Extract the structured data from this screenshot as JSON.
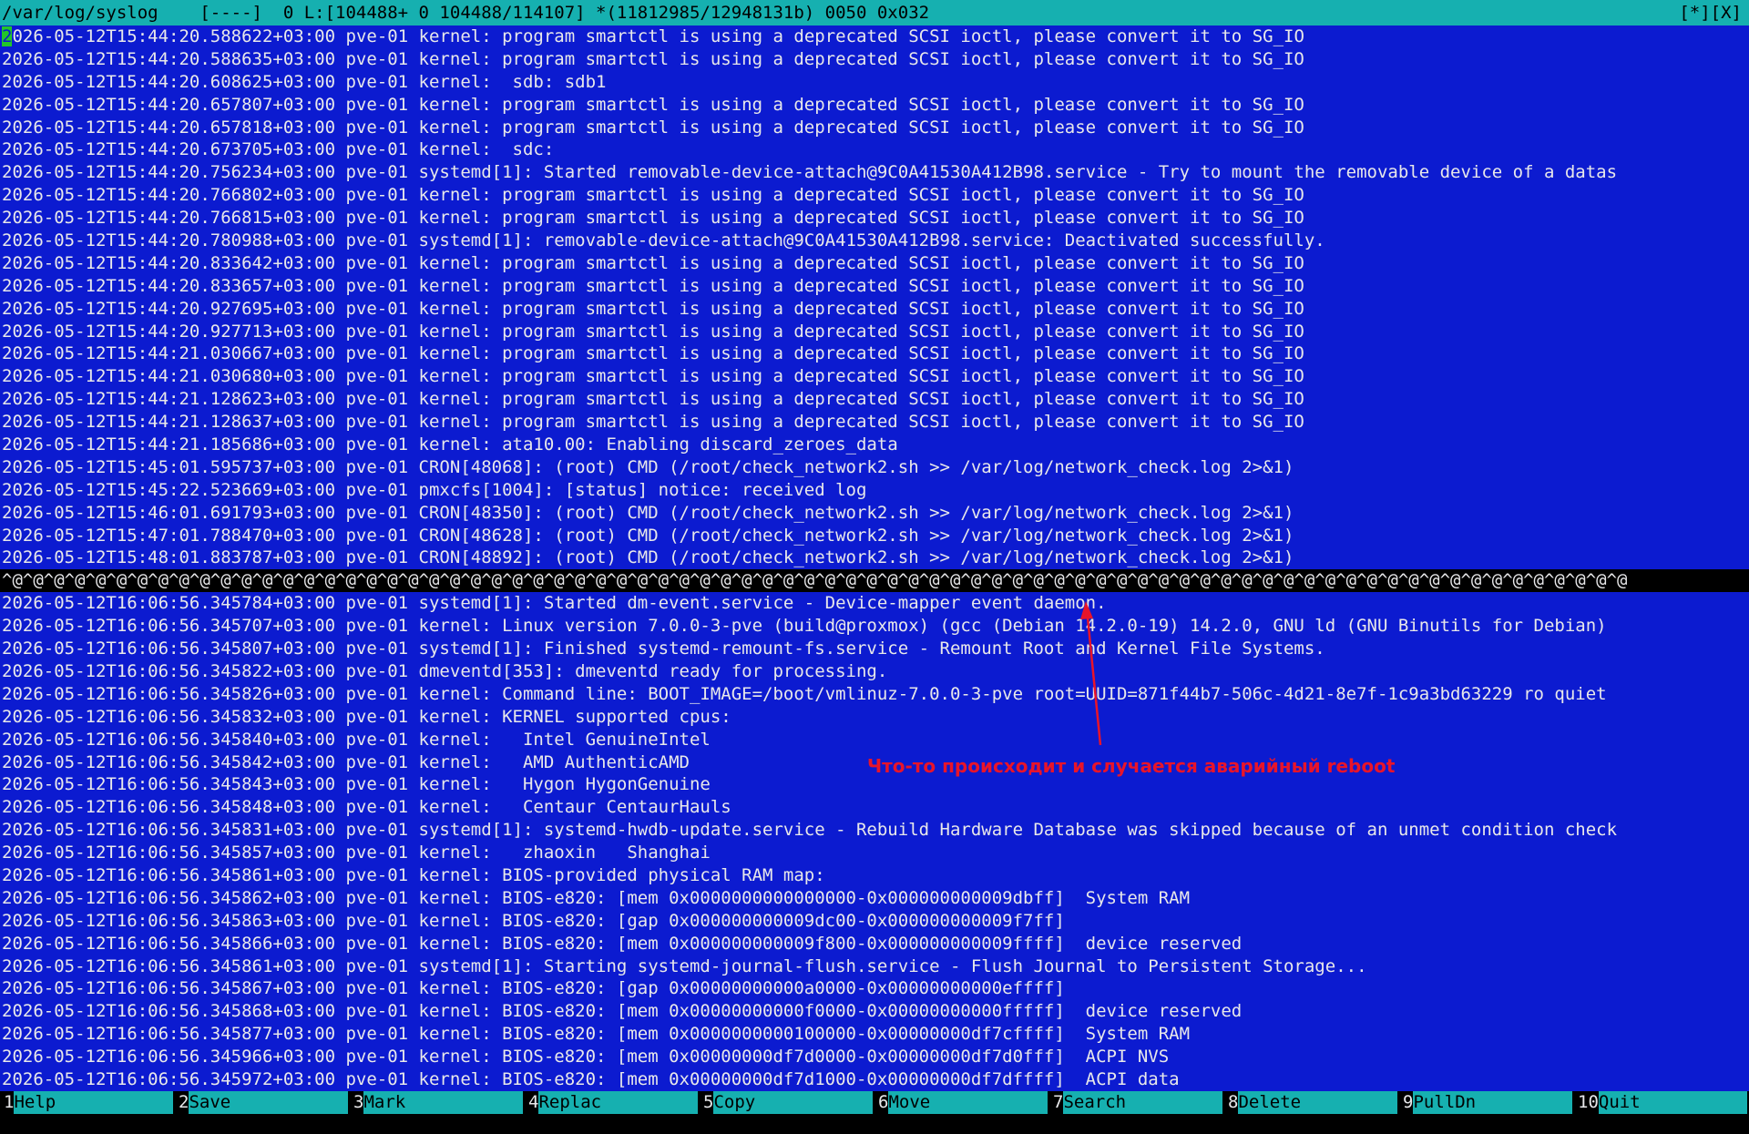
{
  "status": {
    "left": "/var/log/syslog    [----]  0 L:[104488+ 0 104488/114107] *(11812985/12948131b) 0050 0x032",
    "right": "[*][X]"
  },
  "cursor_char": "2",
  "lines": [
    "2026-05-12T15:44:20.588622+03:00 pve-01 kernel: program smartctl is using a deprecated SCSI ioctl, please convert it to SG_IO",
    "2026-05-12T15:44:20.588635+03:00 pve-01 kernel: program smartctl is using a deprecated SCSI ioctl, please convert it to SG_IO",
    "2026-05-12T15:44:20.608625+03:00 pve-01 kernel:  sdb: sdb1",
    "2026-05-12T15:44:20.657807+03:00 pve-01 kernel: program smartctl is using a deprecated SCSI ioctl, please convert it to SG_IO",
    "2026-05-12T15:44:20.657818+03:00 pve-01 kernel: program smartctl is using a deprecated SCSI ioctl, please convert it to SG_IO",
    "2026-05-12T15:44:20.673705+03:00 pve-01 kernel:  sdc:",
    "2026-05-12T15:44:20.756234+03:00 pve-01 systemd[1]: Started removable-device-attach@9C0A41530A412B98.service - Try to mount the removable device of a datas",
    "2026-05-12T15:44:20.766802+03:00 pve-01 kernel: program smartctl is using a deprecated SCSI ioctl, please convert it to SG_IO",
    "2026-05-12T15:44:20.766815+03:00 pve-01 kernel: program smartctl is using a deprecated SCSI ioctl, please convert it to SG_IO",
    "2026-05-12T15:44:20.780988+03:00 pve-01 systemd[1]: removable-device-attach@9C0A41530A412B98.service: Deactivated successfully.",
    "2026-05-12T15:44:20.833642+03:00 pve-01 kernel: program smartctl is using a deprecated SCSI ioctl, please convert it to SG_IO",
    "2026-05-12T15:44:20.833657+03:00 pve-01 kernel: program smartctl is using a deprecated SCSI ioctl, please convert it to SG_IO",
    "2026-05-12T15:44:20.927695+03:00 pve-01 kernel: program smartctl is using a deprecated SCSI ioctl, please convert it to SG_IO",
    "2026-05-12T15:44:20.927713+03:00 pve-01 kernel: program smartctl is using a deprecated SCSI ioctl, please convert it to SG_IO",
    "2026-05-12T15:44:21.030667+03:00 pve-01 kernel: program smartctl is using a deprecated SCSI ioctl, please convert it to SG_IO",
    "2026-05-12T15:44:21.030680+03:00 pve-01 kernel: program smartctl is using a deprecated SCSI ioctl, please convert it to SG_IO",
    "2026-05-12T15:44:21.128623+03:00 pve-01 kernel: program smartctl is using a deprecated SCSI ioctl, please convert it to SG_IO",
    "2026-05-12T15:44:21.128637+03:00 pve-01 kernel: program smartctl is using a deprecated SCSI ioctl, please convert it to SG_IO",
    "2026-05-12T15:44:21.185686+03:00 pve-01 kernel: ata10.00: Enabling discard_zeroes_data",
    "2026-05-12T15:45:01.595737+03:00 pve-01 CRON[48068]: (root) CMD (/root/check_network2.sh >> /var/log/network_check.log 2>&1)",
    "2026-05-12T15:45:22.523669+03:00 pve-01 pmxcfs[1004]: [status] notice: received log",
    "2026-05-12T15:46:01.691793+03:00 pve-01 CRON[48350]: (root) CMD (/root/check_network2.sh >> /var/log/network_check.log 2>&1)",
    "2026-05-12T15:47:01.788470+03:00 pve-01 CRON[48628]: (root) CMD (/root/check_network2.sh >> /var/log/network_check.log 2>&1)",
    "2026-05-12T15:48:01.883787+03:00 pve-01 CRON[48892]: (root) CMD (/root/check_network2.sh >> /var/log/network_check.log 2>&1)",
    "^@^@^@^@^@^@^@^@^@^@^@^@^@^@^@^@^@^@^@^@^@^@^@^@^@^@^@^@^@^@^@^@^@^@^@^@^@^@^@^@^@^@^@^@^@^@^@^@^@^@^@^@^@^@^@^@^@^@^@^@^@^@^@^@^@^@^@^@^@^@^@^@^@^@^@^@^@^@",
    "2026-05-12T16:06:56.345784+03:00 pve-01 systemd[1]: Started dm-event.service - Device-mapper event daemon.",
    "2026-05-12T16:06:56.345707+03:00 pve-01 kernel: Linux version 7.0.0-3-pve (build@proxmox) (gcc (Debian 14.2.0-19) 14.2.0, GNU ld (GNU Binutils for Debian)",
    "2026-05-12T16:06:56.345807+03:00 pve-01 systemd[1]: Finished systemd-remount-fs.service - Remount Root and Kernel File Systems.",
    "2026-05-12T16:06:56.345822+03:00 pve-01 dmeventd[353]: dmeventd ready for processing.",
    "2026-05-12T16:06:56.345826+03:00 pve-01 kernel: Command line: BOOT_IMAGE=/boot/vmlinuz-7.0.0-3-pve root=UUID=871f44b7-506c-4d21-8e7f-1c9a3bd63229 ro quiet",
    "2026-05-12T16:06:56.345832+03:00 pve-01 kernel: KERNEL supported cpus:",
    "2026-05-12T16:06:56.345840+03:00 pve-01 kernel:   Intel GenuineIntel",
    "2026-05-12T16:06:56.345842+03:00 pve-01 kernel:   AMD AuthenticAMD",
    "2026-05-12T16:06:56.345843+03:00 pve-01 kernel:   Hygon HygonGenuine",
    "2026-05-12T16:06:56.345848+03:00 pve-01 kernel:   Centaur CentaurHauls",
    "2026-05-12T16:06:56.345831+03:00 pve-01 systemd[1]: systemd-hwdb-update.service - Rebuild Hardware Database was skipped because of an unmet condition check",
    "2026-05-12T16:06:56.345857+03:00 pve-01 kernel:   zhaoxin   Shanghai",
    "2026-05-12T16:06:56.345861+03:00 pve-01 kernel: BIOS-provided physical RAM map:",
    "2026-05-12T16:06:56.345862+03:00 pve-01 kernel: BIOS-e820: [mem 0x0000000000000000-0x000000000009dbff]  System RAM",
    "2026-05-12T16:06:56.345863+03:00 pve-01 kernel: BIOS-e820: [gap 0x000000000009dc00-0x000000000009f7ff]",
    "2026-05-12T16:06:56.345866+03:00 pve-01 kernel: BIOS-e820: [mem 0x000000000009f800-0x000000000009ffff]  device reserved",
    "2026-05-12T16:06:56.345861+03:00 pve-01 systemd[1]: Starting systemd-journal-flush.service - Flush Journal to Persistent Storage...",
    "2026-05-12T16:06:56.345867+03:00 pve-01 kernel: BIOS-e820: [gap 0x00000000000a0000-0x00000000000effff]",
    "2026-05-12T16:06:56.345868+03:00 pve-01 kernel: BIOS-e820: [mem 0x00000000000f0000-0x00000000000fffff]  device reserved",
    "2026-05-12T16:06:56.345877+03:00 pve-01 kernel: BIOS-e820: [mem 0x0000000000100000-0x00000000df7cffff]  System RAM",
    "2026-05-12T16:06:56.345966+03:00 pve-01 kernel: BIOS-e820: [mem 0x00000000df7d0000-0x00000000df7d0fff]  ACPI NVS",
    "2026-05-12T16:06:56.345972+03:00 pve-01 kernel: BIOS-e820: [mem 0x00000000df7d1000-0x00000000df7dffff]  ACPI data"
  ],
  "annotation": "Что-то происходит и случается аварийный reboot",
  "fkeys": [
    {
      "num": "1",
      "label": "Help"
    },
    {
      "num": "2",
      "label": "Save"
    },
    {
      "num": "3",
      "label": "Mark"
    },
    {
      "num": "4",
      "label": "Replac"
    },
    {
      "num": "5",
      "label": "Copy"
    },
    {
      "num": "6",
      "label": "Move"
    },
    {
      "num": "7",
      "label": "Search"
    },
    {
      "num": "8",
      "label": "Delete"
    },
    {
      "num": "9",
      "label": "PullDn"
    },
    {
      "num": "10",
      "label": "Quit"
    }
  ],
  "colors": {
    "background": "#0c1bd0",
    "text": "#e8e8ea",
    "status_bar": "#16b0b0",
    "cursor": "#22c62a",
    "annotation": "#e8142a"
  }
}
